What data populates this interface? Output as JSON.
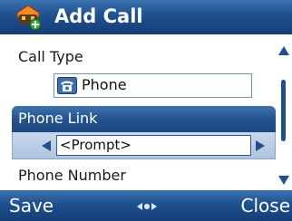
{
  "window": {
    "title": "Add Call",
    "title_icon": "add-call-icon"
  },
  "form": {
    "call_type": {
      "label": "Call Type",
      "value": "Phone",
      "icon": "telephone-icon"
    },
    "phone_link": {
      "label": "Phone Link",
      "value": "<Prompt>"
    },
    "phone_number": {
      "label": "Phone Number"
    }
  },
  "softkeys": {
    "left_label": "Save",
    "right_label": "Close",
    "center_icon": "navigation-indicator-icon"
  },
  "scrollbar": {
    "position": 0.25
  },
  "colors": {
    "title_bar": "#1f5090",
    "accent": "#1f4f8c",
    "selected_row_bg": "#c9d8ea",
    "field_border": "#6f93bb"
  }
}
